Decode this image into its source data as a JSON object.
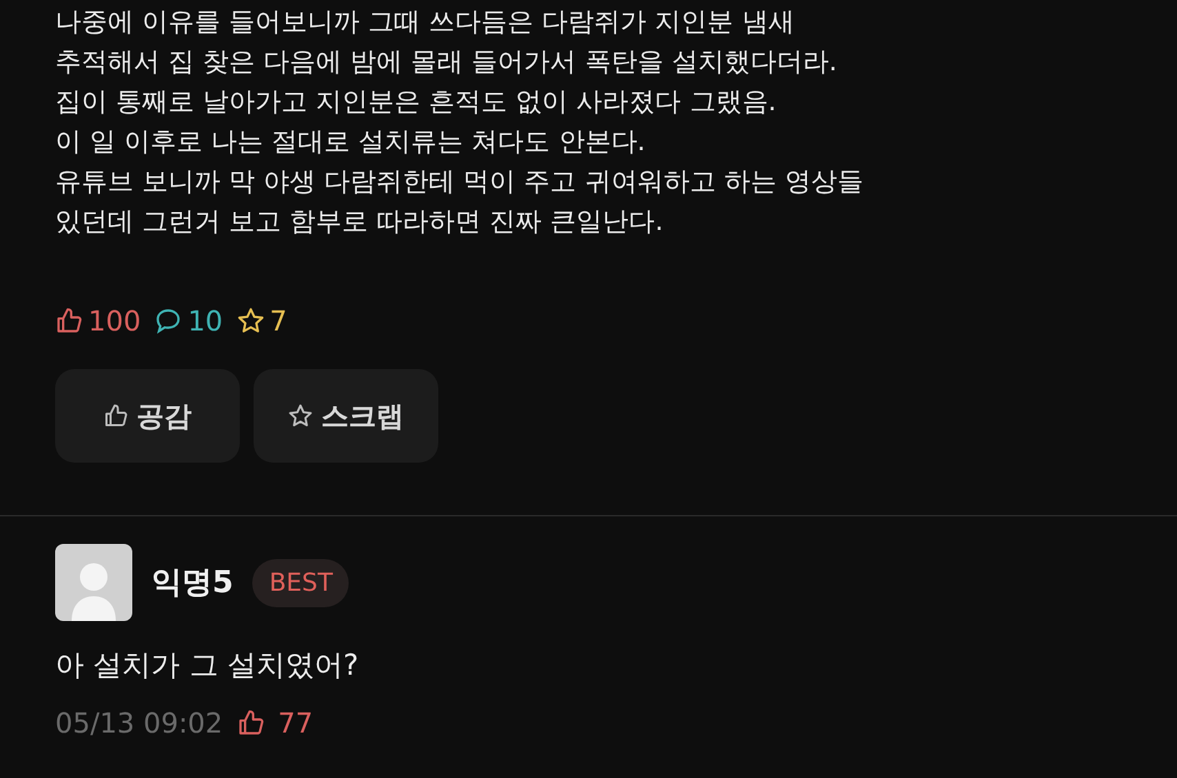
{
  "post": {
    "lines": [
      "나중에 이유를 들어보니까 그때 쓰다듬은 다람쥐가 지인분 냄새",
      "추적해서 집 찾은 다음에 밤에 몰래 들어가서 폭탄을 설치했다더라.",
      "집이 통째로 날아가고 지인분은 흔적도 없이 사라졌다 그랬음.",
      "이 일 이후로 나는 절대로 설치류는 쳐다도 안본다.",
      "유튜브 보니까 막 야생 다람쥐한테 먹이 주고 귀여워하고 하는 영상들",
      "있던데 그런거 보고 함부로 따라하면 진짜 큰일난다."
    ],
    "stats": [
      {
        "kind": "like",
        "count": "100",
        "color": "#d9605e"
      },
      {
        "kind": "comment",
        "count": "10",
        "color": "#3fb3b3"
      },
      {
        "kind": "scrap",
        "count": "7",
        "color": "#e6bf52"
      }
    ],
    "buttons": [
      {
        "kind": "like",
        "label": "공감"
      },
      {
        "kind": "scrap",
        "label": "스크랩"
      }
    ]
  },
  "comment": {
    "author": "익명5",
    "badge": "BEST",
    "text": "아 설치가 그 설치였어?",
    "time": "05/13 09:02",
    "likes": "77"
  }
}
